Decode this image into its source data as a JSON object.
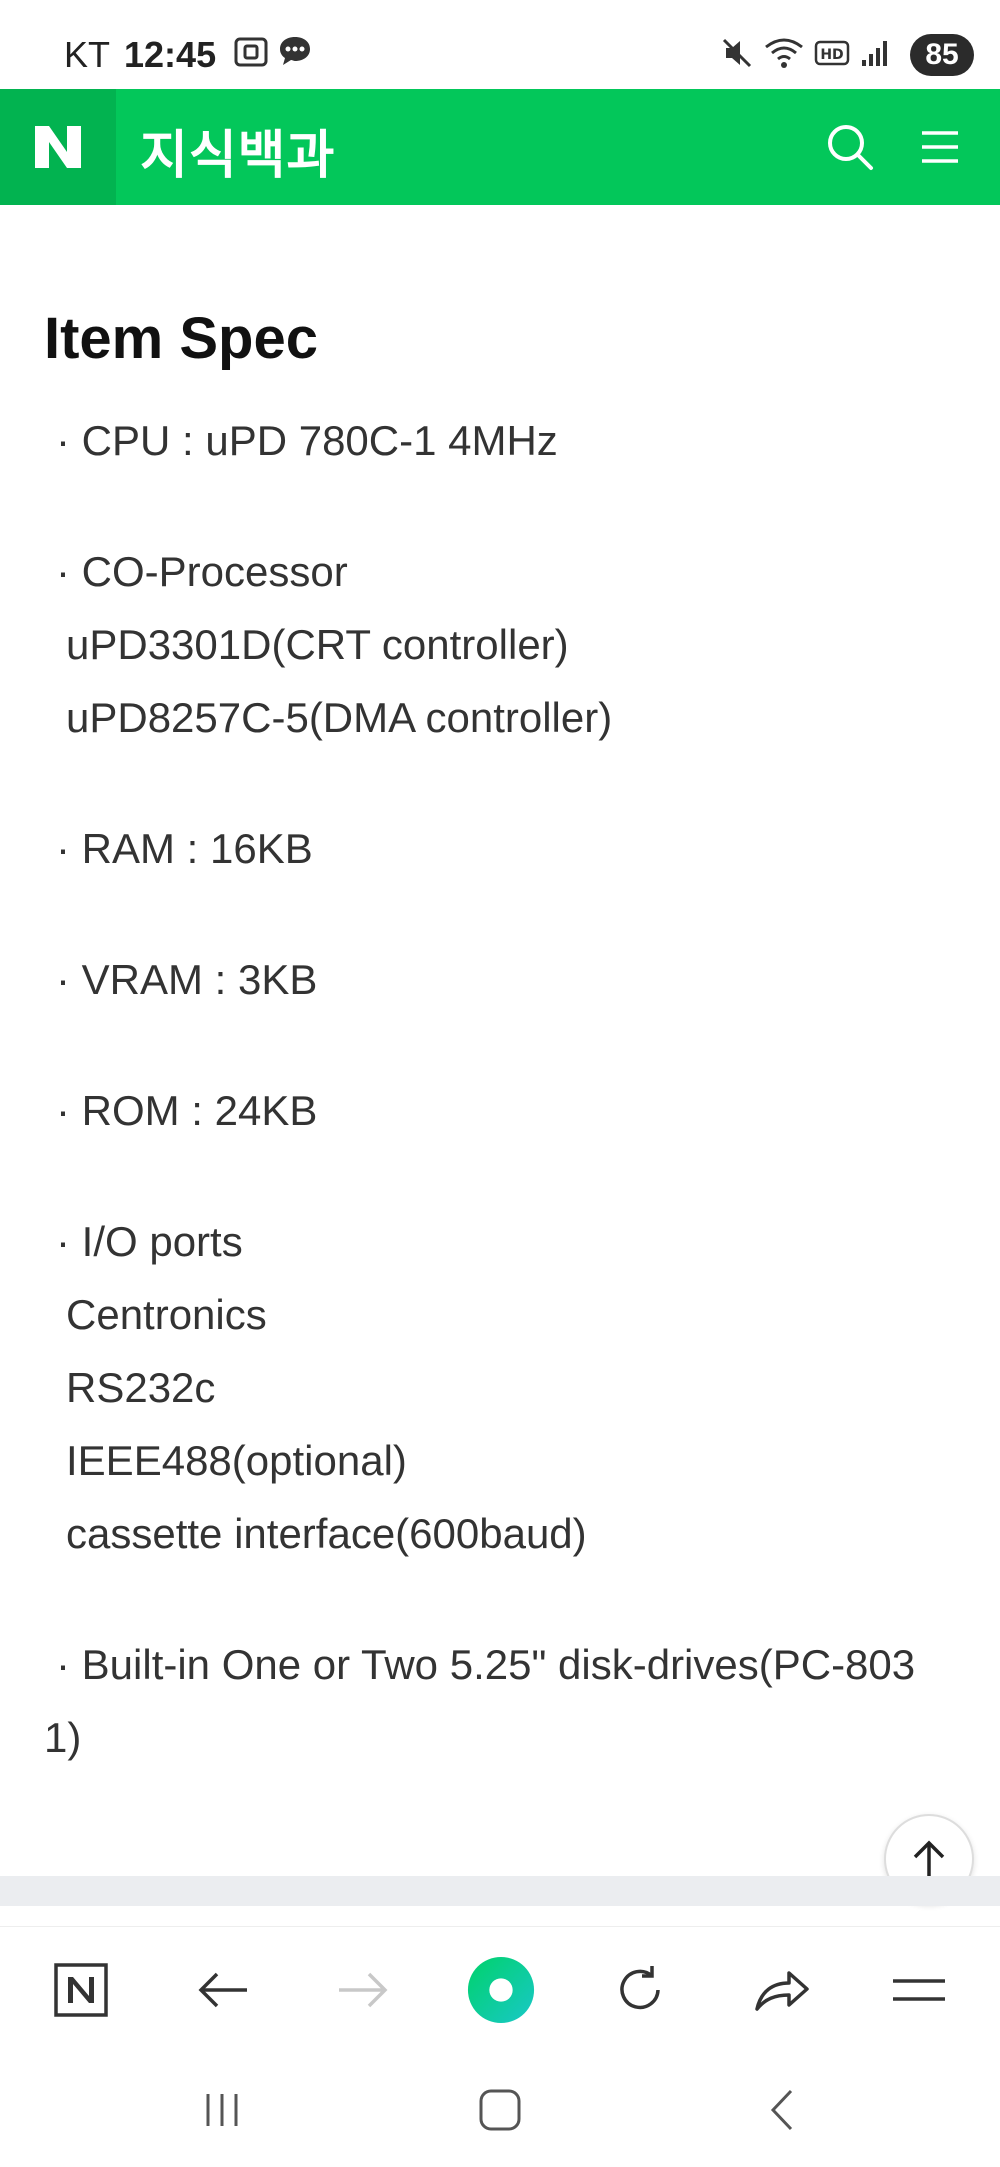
{
  "status_bar": {
    "carrier": "KT",
    "time": "12:45",
    "battery": "85",
    "icons": [
      "screenshot-icon",
      "chat-icon",
      "mute-icon",
      "wifi-icon",
      "hd-icon",
      "signal-icon"
    ]
  },
  "header": {
    "logo": "N",
    "title": "지식백과",
    "icons": [
      "search-icon",
      "menu-icon"
    ]
  },
  "content": {
    "section_title": "Item Spec",
    "lines": [
      "· CPU : uPD 780C-1 4MHz",
      "· CO-Processor",
      "uPD3301D(CRT controller)",
      "uPD8257C-5(DMA controller)",
      "· RAM : 16KB",
      "· VRAM : 3KB",
      "· ROM : 24KB",
      "· I/O ports",
      "Centronics",
      "RS232c",
      "IEEE488(optional)",
      "cassette interface(600baud)",
      "· Built-in One or Two 5.25\" disk-drives(PC-803",
      "1)"
    ]
  },
  "toolbar": {
    "icons": [
      "naver-home-icon",
      "back-arrow-icon",
      "forward-arrow-icon",
      "green-dot-icon",
      "refresh-icon",
      "share-icon",
      "menu-icon"
    ]
  },
  "navbar": {
    "icons": [
      "recent-apps-icon",
      "home-icon",
      "back-icon"
    ]
  },
  "colors": {
    "brand_green": "#03c75a",
    "logo_green": "#02b350",
    "text": "#333333"
  }
}
